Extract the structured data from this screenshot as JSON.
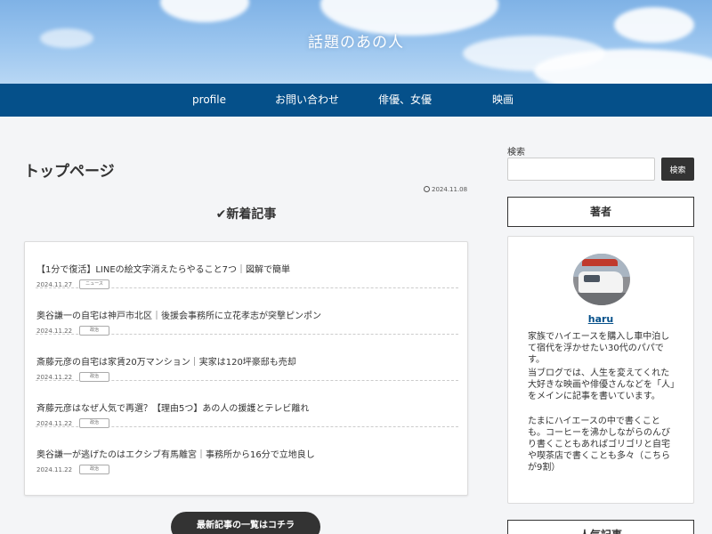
{
  "site": {
    "title": "話題のあの人"
  },
  "nav": {
    "items": [
      "profile",
      "お問い合わせ",
      "俳優、女優",
      "映画"
    ]
  },
  "main": {
    "page_title": "トップページ",
    "date": "2024.11.08",
    "section_title": "✔新着記事",
    "articles": [
      {
        "title": "【1分で復活】LINEの絵文字消えたらやること7つ｜図解で簡単",
        "date": "2024.11.27",
        "category": "ニュース"
      },
      {
        "title": "奥谷謙一の自宅は神戸市北区｜後援会事務所に立花孝志が突撃ピンポン",
        "date": "2024.11.22",
        "category": "政治"
      },
      {
        "title": "斎藤元彦の自宅は家賃20万マンション｜実家は120坪豪邸も売却",
        "date": "2024.11.22",
        "category": "政治"
      },
      {
        "title": "斉藤元彦はなぜ人気で再選？【理由5つ】あの人の援護とテレビ離れ",
        "date": "2024.11.22",
        "category": "政治"
      },
      {
        "title": "奥谷謙一が逃げたのはエクシブ有馬離宮｜事務所から16分で立地良し",
        "date": "2024.11.22",
        "category": "政治"
      }
    ],
    "more_button": "最新記事の一覧はコチラ"
  },
  "sidebar": {
    "search_label": "検索",
    "search_value": "",
    "search_button": "検索",
    "author_heading": "著者",
    "author_name": "haru",
    "author_bio": [
      "家族でハイエースを購入し車中泊して宿代を浮かせたい30代のパパです。",
      "当ブログでは、人生を変えてくれた大好きな映画や俳優さんなどを「人」をメインに記事を書いています。",
      "たまにハイエースの中で書くことも。コーヒーを沸かしながらのんびり書くこともあればゴリゴリと自宅や喫茶店で書くことも多々（こちらが9割）"
    ],
    "popular_heading": "人気記事"
  },
  "colors": {
    "nav_bg": "#05508a",
    "button_dark": "#333333",
    "link": "#05508a"
  }
}
